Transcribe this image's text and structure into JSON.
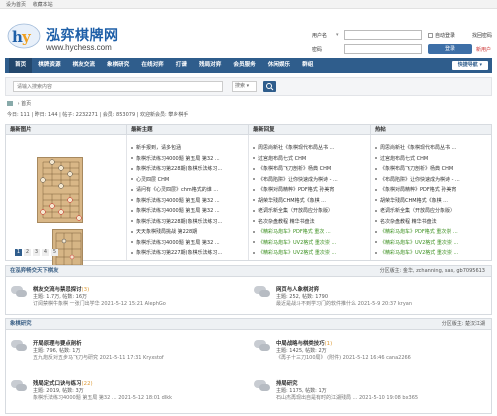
{
  "topbar": {
    "set_home": "设为首页",
    "bookmark": "收藏本站"
  },
  "logo": {
    "title": "泓弈棋牌网",
    "url": "www.hychess.com",
    "mark": "hy"
  },
  "login": {
    "username_label": "用户名",
    "password_label": "密码",
    "username_select": "▾",
    "auto_login": "自动登录",
    "forgot_password": "找回密码",
    "login_button": "登录",
    "register": "新用户"
  },
  "nav": {
    "items": [
      "首页",
      "棋牌资源",
      "棋友交流",
      "象棋研究",
      "在线对弈",
      "打谱",
      "残局对弈",
      "会员服务",
      "休闲娱乐",
      "群组"
    ],
    "quick": "快捷导航 ▾"
  },
  "search": {
    "placeholder": "请输入搜索内容",
    "type": "搜索 ▾"
  },
  "breadcrumb": "› 首页",
  "stats": "今日: 111 | 昨日: 144 | 帖子: 2232271 | 会员: 853079 | 欢迎新会员: 攀乡棋手",
  "panel": {
    "headers": [
      "最新图片",
      "最新主题",
      "最新回复",
      "热帖"
    ],
    "pager": [
      "1",
      "2",
      "3",
      "4",
      "5"
    ],
    "col1": [
      "新手报到，请多包涵",
      "象棋乐法练习4000题 第五局 第32 ...",
      "象棋乐法练习第228期(象棋乐法练习...",
      "心灵四层 CHM",
      "请问有《心灵四层》chm格式的谁 ...",
      "象棋乐法练习4000题 第五局 第32 ...",
      "象棋乐法练习4000题 第五局 第32 ...",
      "象棋乐法练习第228期(象棋乐法练习...",
      "天天象棋残局挑战 第228期",
      "象棋乐法练习4000题 第五局 第32 ...",
      "象棋乐法练习第227期(象棋乐法练习..."
    ],
    "col2": [
      "周思尚新社《象棋现代布局丛书 ...",
      "过宫炮布局七式 CHM",
      "《象棋布局飞刀剖析》杨典 CHM",
      "《布局陷阱》让你快速成为棋诗 - ...",
      "《象棋对局精粹》PDF格式 孙美宵",
      "胡荣华残局CHM格式《象棋 ...",
      "老调乐新全集（开放局应分象版）",
      "名次杂盘教程 精华书盘法",
      "《精彩马炮车》PDF格式 重次 ...",
      "《精彩马炮车》UV2格式 重次崇 ...",
      "《精彩马炮车》UV2格式 重次崇 ..."
    ],
    "col2_green": [
      8,
      9,
      10
    ],
    "col3": [
      "周思尚新社《象棋现代布局丛书 ...",
      "过宫炮布局七式 CHM",
      "《象棋布局飞刀剖析》杨典 CHM",
      "《布局陷阱》让你快速成为棋诗 - ...",
      "《象棋对局精粹》PDF格式 孙美宵",
      "胡荣华残局CHM格式《象棋 ...",
      "老调乐新全集（开放局应分象版）",
      "名次杂盘教程 精华书盘法",
      "《精彩马炮车》PDF格式 重次崇 ...",
      "《精彩马炮车》UV2格式 重次崇 ...",
      "《精彩马炮车》UV2格式 重次崇 ..."
    ],
    "col3_green": [
      8,
      9,
      10
    ]
  },
  "section1": {
    "title": "在泓弈畅交天下棋友",
    "moderators": "分区版主: 金华, zchanning, sas, gb7095613",
    "forums": [
      {
        "title": "棋友交流与禁忌探讨",
        "new": "(3)",
        "stats": "主题: 1.7万, 帖数: 16万",
        "last": "订阅禁棋牛象棋 一张门出学华 2021-5-12 15:21 AlephGo"
      },
      {
        "title": "网页与人象棋对弈",
        "new": "",
        "stats": "主题: 252, 帖数: 1790",
        "last": "最近是战斗不到学习门的软件推什么 2021-5-9 20:37 kryan"
      }
    ]
  },
  "section2": {
    "title": "象棋研究",
    "moderators": "分区版主: 楚汉江湖",
    "forums": [
      {
        "title": "开局原理与要点剖析",
        "new": "",
        "stats": "主题: 796, 帖数: 1万",
        "last": "五九炮反对五步马飞刀与研究 2021-5-11 17:31 Kryxstof"
      },
      {
        "title": "中局战略与棋类技巧",
        "new": "(1)",
        "stats": "主题: 1425, 帖数: 2万",
        "last": "《再子十三刀100局》 (附件) 2021-5-12 16:46 cana2266"
      },
      {
        "title": "残局定式口诀与练习",
        "new": "(22)",
        "stats": "主题: 2019, 帖数: 3万",
        "last": "象棋乐法练习4000题 第五局 第32 ... 2021-5-12 18:01 dlkk"
      },
      {
        "title": "排局研究",
        "new": "",
        "stats": "主题: 1175, 帖数: 1万",
        "last": "石山杰再现出自是有时的江湖残局 ... 2021-5-10 19:08 bx365"
      }
    ]
  },
  "colors": {
    "nav": "#2f5d8c",
    "accent": "#1e5fa8",
    "green": "#3a8f1e",
    "new": "#dd9933"
  }
}
